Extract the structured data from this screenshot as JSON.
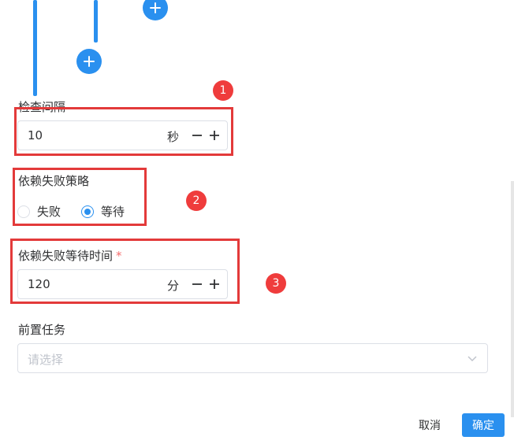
{
  "flow": {
    "add_label": "+"
  },
  "check_interval": {
    "label": "检查间隔",
    "value": "10",
    "unit": "秒",
    "badge": "1"
  },
  "failure_strategy": {
    "label": "依赖失败策略",
    "badge": "2",
    "options": [
      {
        "label": "失败",
        "checked": false
      },
      {
        "label": "等待",
        "checked": true
      }
    ]
  },
  "failure_wait": {
    "label": "依赖失败等待时间",
    "required_mark": "*",
    "value": "120",
    "unit": "分",
    "badge": "3"
  },
  "pre_task": {
    "label": "前置任务",
    "placeholder": "请选择"
  },
  "footer": {
    "cancel": "取消",
    "confirm": "确定"
  },
  "colors": {
    "primary": "#2a90ef",
    "annotation_red": "#e33a3a",
    "required": "#f56c6c"
  }
}
